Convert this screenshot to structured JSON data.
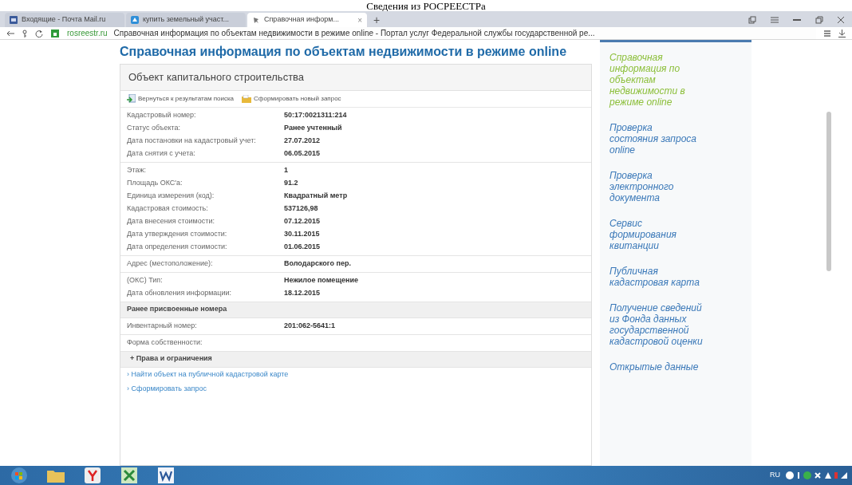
{
  "caption": "Сведения из РОСРЕЕСТРа",
  "tabs": [
    {
      "label": "Входящие - Почта Mail.ru",
      "selected": false
    },
    {
      "label": "купить земельный участ...",
      "selected": false
    },
    {
      "label": "Справочная информ...",
      "selected": true,
      "close": "×"
    }
  ],
  "new_tab": "+",
  "address": {
    "domain": "rosreestr.ru",
    "title": "Справочная информация по объектам недвижимости в режиме online - Портал услуг Федеральной службы государственной ре..."
  },
  "page_title": "Справочная информация по объектам недвижимости в режиме online",
  "card": {
    "title": "Объект капитального строительства",
    "actions": [
      "Вернуться к результатам поиска",
      "Сформировать новый запрос"
    ],
    "blocks": [
      {
        "kind": "fields",
        "rows": [
          {
            "label": "Кадастровый номер:",
            "value": "50:17:0021311:214"
          },
          {
            "label": "Статус объекта:",
            "value": "Ранее учтенный"
          },
          {
            "label": "Дата постановки на кадастровый учет:",
            "value": "27.07.2012"
          },
          {
            "label": "Дата снятия с учета:",
            "value": "06.05.2015"
          }
        ]
      },
      {
        "kind": "fields",
        "rows": [
          {
            "label": "Этаж:",
            "value": "1"
          },
          {
            "label": "Площадь ОКС'a:",
            "value": "91.2"
          },
          {
            "label": "Единица измерения (код):",
            "value": "Квадратный метр"
          },
          {
            "label": "Кадастровая стоимость:",
            "value": "537126,98"
          },
          {
            "label": "Дата внесения стоимости:",
            "value": "07.12.2015"
          },
          {
            "label": "Дата утверждения стоимости:",
            "value": "30.11.2015"
          },
          {
            "label": "Дата определения стоимости:",
            "value": "01.06.2015"
          }
        ]
      },
      {
        "kind": "fields",
        "rows": [
          {
            "label": "Адрес (местоположение):",
            "value": "Володарского пер."
          }
        ]
      },
      {
        "kind": "fields",
        "rows": [
          {
            "label": "(ОКС) Тип:",
            "value": "Нежилое помещение"
          },
          {
            "label": "Дата обновления информации:",
            "value": "18.12.2015"
          }
        ]
      },
      {
        "kind": "heading",
        "label": "Ранее присвоенные номера"
      },
      {
        "kind": "fields",
        "rows": [
          {
            "label": "Инвентарный номер:",
            "value": "201:062-5641:1"
          }
        ]
      },
      {
        "kind": "fields",
        "rows": [
          {
            "label": "Форма собственности:"
          }
        ]
      },
      {
        "kind": "expander",
        "label": "Права и ограничения",
        "marker": "+",
        "expanded": false
      },
      {
        "kind": "link",
        "label": "› Найти объект на публичной кадастровой карте"
      },
      {
        "kind": "link",
        "label": "› Сформировать запрос"
      }
    ]
  },
  "sidebar": [
    {
      "label": "Справочная информация по объектам недвижимости в режиме online",
      "selected": true
    },
    {
      "label": "Проверка состояния запроса online",
      "selected": false
    },
    {
      "label": "Проверка электронного документа",
      "selected": false
    },
    {
      "label": "Сервис формирования квитанции",
      "selected": false
    },
    {
      "label": "Публичная кадастровая карта",
      "selected": false
    },
    {
      "label": "Получение сведений из Фонда данных государственной кадастровой оценки",
      "selected": false
    },
    {
      "label": "Открытые данные",
      "selected": false
    }
  ],
  "taskbar": {
    "language": "RU"
  }
}
